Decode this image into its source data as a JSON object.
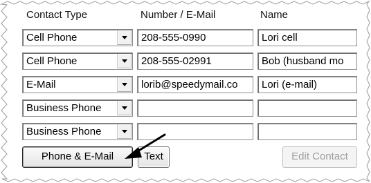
{
  "headers": {
    "contact_type": "Contact Type",
    "number_email": "Number / E-Mail",
    "name": "Name"
  },
  "rows": [
    {
      "contact_type": "Cell Phone",
      "number": "208-555-0990",
      "name": "Lori cell"
    },
    {
      "contact_type": "Cell Phone",
      "number": "208-555-02991",
      "name": "Bob (husband mo"
    },
    {
      "contact_type": "E-Mail",
      "number": "lorib@speedymail.co",
      "name": "Lori (e-mail)"
    },
    {
      "contact_type": "Business Phone",
      "number": "",
      "name": ""
    },
    {
      "contact_type": "Business Phone",
      "number": "",
      "name": ""
    }
  ],
  "buttons": {
    "phone_email": "Phone & E-Mail",
    "text": "Text",
    "edit_contact": "Edit Contact"
  },
  "icons": {
    "dropdown": "chevron-down-icon",
    "annotation_arrow": "pointer-arrow-icon"
  },
  "colors": {
    "field_border": "#8a8a8a",
    "disabled_text": "#9e9e9e",
    "background": "#ffffff"
  }
}
